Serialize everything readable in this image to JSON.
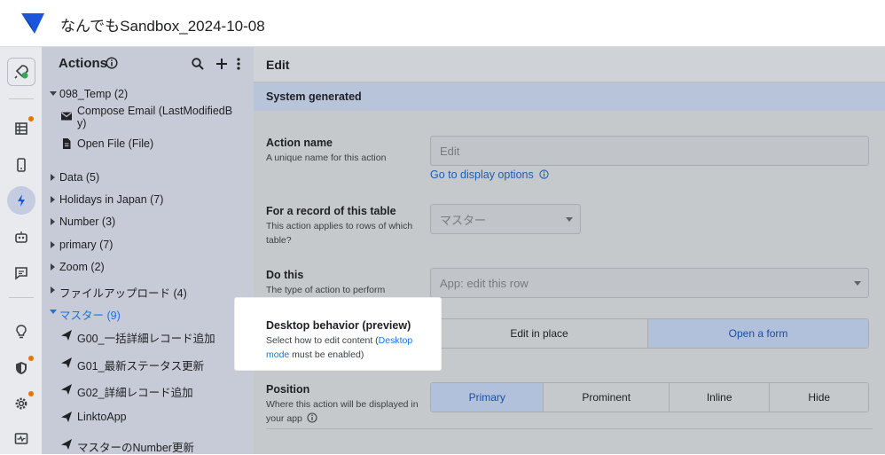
{
  "app": {
    "title": "なんでもSandbox_2024-10-08"
  },
  "rail": {
    "items": [
      {
        "name": "launch-icon"
      },
      {
        "name": "data-icon",
        "badge": true
      },
      {
        "name": "app-view-icon"
      },
      {
        "name": "actions-icon",
        "active": true
      },
      {
        "name": "bot-icon"
      },
      {
        "name": "chat-icon"
      },
      {
        "name": "intelligence-icon"
      },
      {
        "name": "security-icon",
        "badge": true
      },
      {
        "name": "settings-icon",
        "badge": true
      },
      {
        "name": "monitor-icon"
      }
    ]
  },
  "actions_panel": {
    "title": "Actions",
    "tree": [
      {
        "label": "098_Temp (2)",
        "expanded": true
      },
      {
        "label": "Compose Email (LastModifiedB",
        "label2": "y)",
        "icon": "mail-icon"
      },
      {
        "label": "Open File (File)",
        "icon": "file-icon"
      },
      {
        "label": "Data (5)"
      },
      {
        "label": "Holidays in Japan (7)"
      },
      {
        "label": "Number (3)"
      },
      {
        "label": "primary (7)"
      },
      {
        "label": "Zoom (2)"
      },
      {
        "label": "ファイルアップロード (4)"
      },
      {
        "label": "マスター (9)",
        "expanded": true
      },
      {
        "label": "G00_一括詳細レコード追加",
        "icon": "send-icon"
      },
      {
        "label": "G01_最新ステータス更新",
        "icon": "send-icon"
      },
      {
        "label": "G02_詳細レコード追加",
        "icon": "send-icon"
      },
      {
        "label": "LinktoApp",
        "icon": "send-icon"
      },
      {
        "label": "マスターのNumber更新",
        "icon": "send-icon"
      }
    ]
  },
  "editor": {
    "header": "Edit",
    "section": "System generated",
    "action_name": {
      "title": "Action name",
      "desc": "A unique name for this action",
      "value": "Edit",
      "link": "Go to display options"
    },
    "table": {
      "title": "For a record of this table",
      "desc": "This action applies to rows of which table?",
      "value": "マスター"
    },
    "do_this": {
      "title": "Do this",
      "desc": "The type of action to perform",
      "value": "App: edit this row"
    },
    "desktop": {
      "title": "Desktop behavior (preview)",
      "desc_before": "Select how to edit content (",
      "desc_link": "Desktop mode",
      "desc_after": " must be enabled)",
      "options": [
        "Edit in place",
        "Open a form"
      ],
      "selected": "Open a form"
    },
    "position": {
      "title": "Position",
      "desc": "Where this action will be displayed in your app",
      "options": [
        "Primary",
        "Prominent",
        "Inline",
        "Hide"
      ],
      "selected": "Primary"
    }
  },
  "colors": {
    "accent": "#1a73e8",
    "badge": "#e37400",
    "brand": "#1a56db"
  }
}
